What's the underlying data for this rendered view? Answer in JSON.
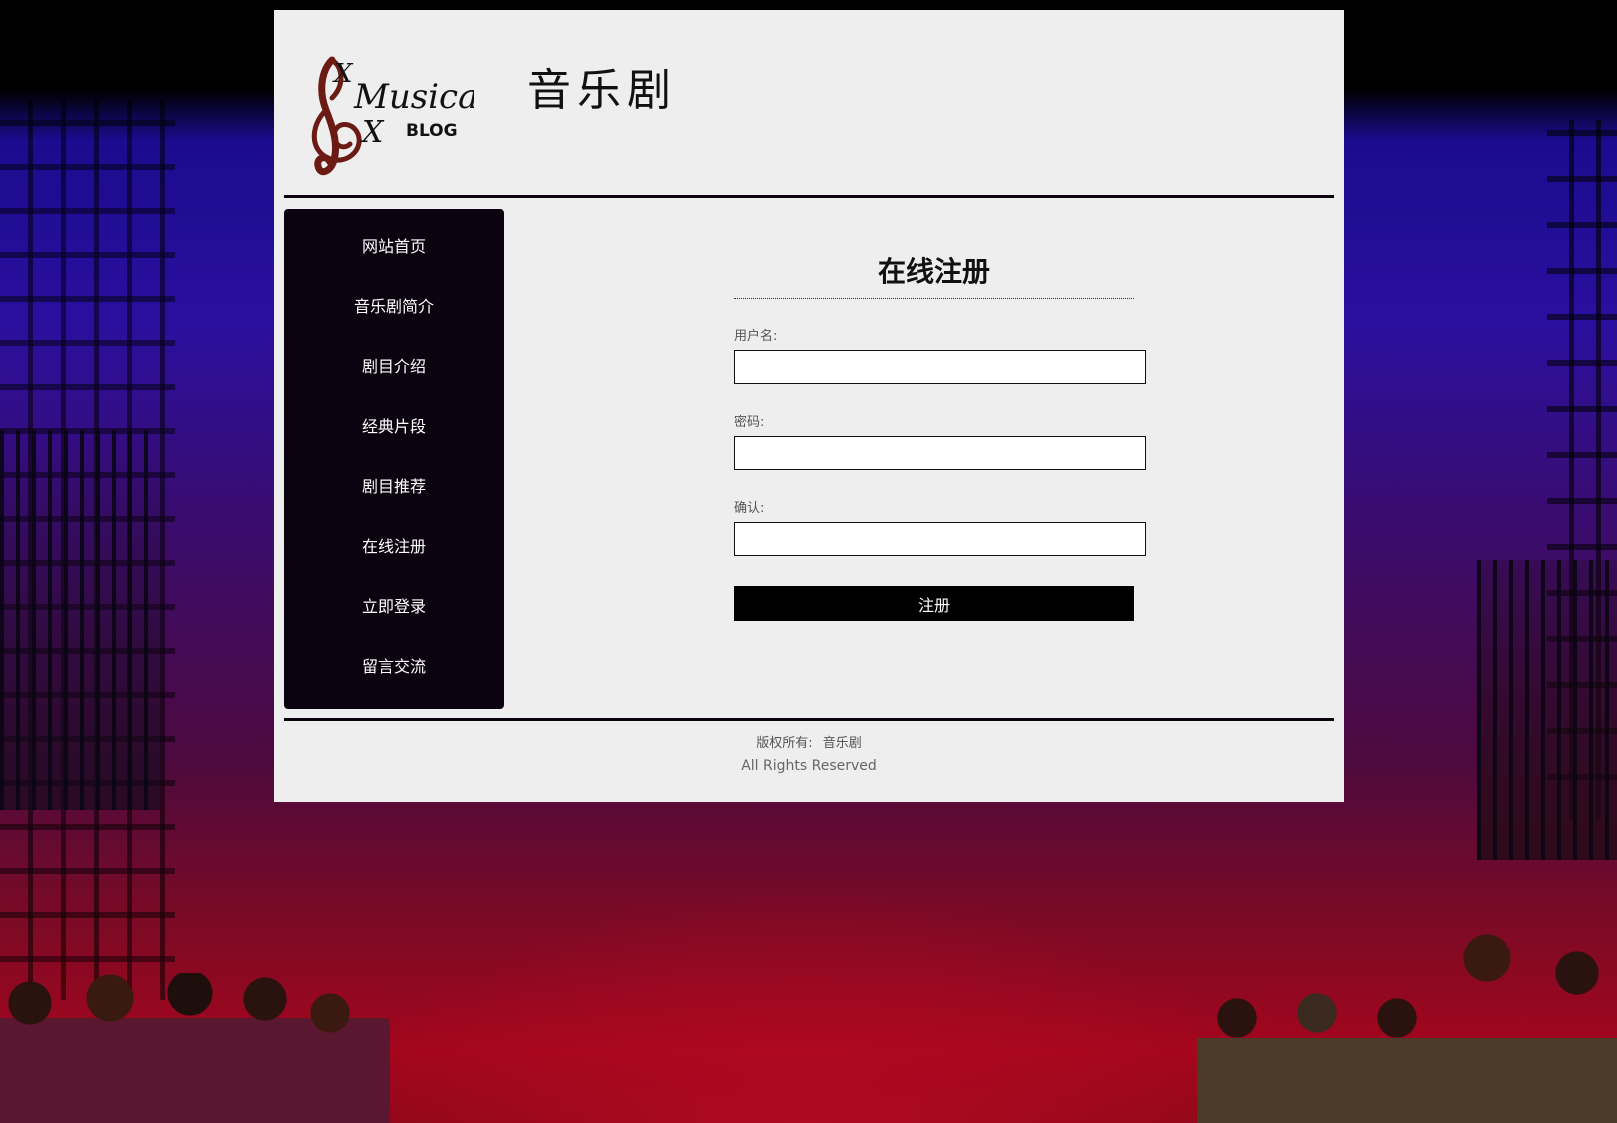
{
  "header": {
    "logo": {
      "text_main": "Musical",
      "text_sub": "BLOG",
      "letters": [
        "X",
        "X"
      ],
      "clef_color": "#6b1a14"
    },
    "title": "音乐剧"
  },
  "nav": {
    "items": [
      {
        "label": "网站首页"
      },
      {
        "label": "音乐剧简介"
      },
      {
        "label": "剧目介绍"
      },
      {
        "label": "经典片段"
      },
      {
        "label": "剧目推荐"
      },
      {
        "label": "在线注册"
      },
      {
        "label": "立即登录"
      },
      {
        "label": "留言交流"
      }
    ]
  },
  "form": {
    "title": "在线注册",
    "fields": [
      {
        "label": "用户名:",
        "value": ""
      },
      {
        "label": "密码:",
        "value": ""
      },
      {
        "label": "确认:",
        "value": ""
      }
    ],
    "submit_label": "注册"
  },
  "footer": {
    "copyright_label": "版权所有:",
    "owner": "音乐剧",
    "rights": "All Rights Reserved"
  },
  "colors": {
    "panel": "#eeeeee",
    "nav_bg": "#0b0310",
    "button_bg": "#000000"
  }
}
